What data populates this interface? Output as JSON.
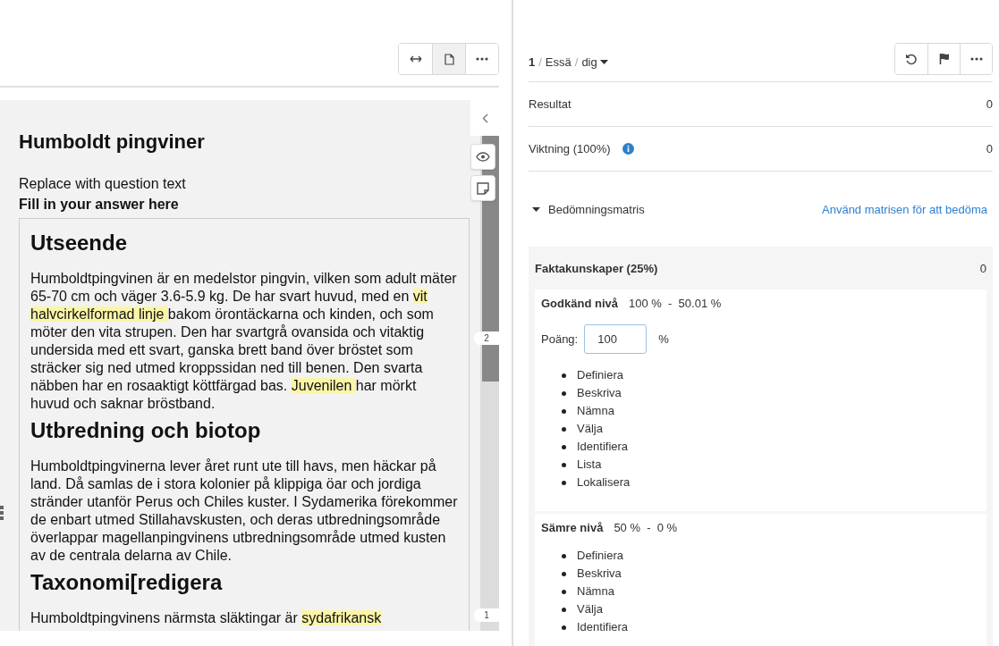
{
  "left_toolbar": {
    "buttons": [
      {
        "kind": "expand",
        "selected": false
      },
      {
        "kind": "page",
        "selected": true
      },
      {
        "kind": "more",
        "selected": false
      }
    ]
  },
  "question": {
    "title": "Humboldt pingviner",
    "text": "Replace with question text",
    "prompt": "Fill in your answer here",
    "answer": [
      {
        "kind": "heading",
        "text": "Utseende"
      },
      {
        "kind": "paragraph",
        "segments": [
          {
            "text": "Humboldtpingvinen är en medelstor pingvin, vilken som adult mäter 65-70 cm och väger 3.6-5.9 kg. De har svart huvud, med en ",
            "highlighted": false
          },
          {
            "text": "vit halvcirkelformad linje ",
            "highlighted": true
          },
          {
            "text": "bakom örontäckarna och kinden, och som möter den vita strupen. Den har svartgrå ovansida och vitaktig undersida med ett svart, ganska brett band över bröstet som sträcker sig ned utmed kroppssidan ned till benen. Den svarta näbben har en rosaaktigt köttfärgad bas. ",
            "highlighted": false
          },
          {
            "text": "Juvenilen ",
            "highlighted": true
          },
          {
            "text": "har mörkt huvud och saknar bröstband.",
            "highlighted": false
          }
        ]
      },
      {
        "kind": "heading",
        "text": "Utbredning och biotop"
      },
      {
        "kind": "paragraph",
        "segments": [
          {
            "text": "Humboldtpingvinerna lever året runt ute till havs, men häckar på land. Då samlas de i stora kolonier på klippiga öar och jordiga stränder utanför Perus och Chiles kuster. I Sydamerika förekommer de enbart utmed Stillahavskusten, och deras utbredningsområde överlappar magellanpingvinens utbredningsområde utmed kusten av de centrala delarna av Chile.",
            "highlighted": false
          }
        ]
      },
      {
        "kind": "heading",
        "text": "Taxonomi[redigera"
      },
      {
        "kind": "paragraph",
        "segments": [
          {
            "text": "Humboldtpingvinens närmsta släktingar är ",
            "highlighted": false
          },
          {
            "text": "sydafrikansk",
            "highlighted": true
          }
        ]
      }
    ]
  },
  "side_rail": {
    "markers": [
      {
        "label": "2"
      },
      {
        "label": "1"
      }
    ]
  },
  "header": {
    "number": "1",
    "separator": "/",
    "type": "Essä",
    "user": "dig"
  },
  "right_toolbar": {
    "buttons": [
      {
        "kind": "undo"
      },
      {
        "kind": "flag"
      },
      {
        "kind": "more"
      }
    ]
  },
  "rows": [
    {
      "label": "Resultat",
      "value": "0",
      "info": false
    },
    {
      "label": "Viktning (100%)",
      "value": "0",
      "info": true
    }
  ],
  "rubric": {
    "title": "Bedömningsmatris",
    "expanded": true,
    "link": "Använd matrisen för att bedöma",
    "criteria": [
      {
        "name": "Faktakunskaper (25%)",
        "score": "0",
        "levels": [
          {
            "name": "Godkänd nivå",
            "range": "100 %  -  50.01 %",
            "points_label": "Poäng:",
            "points": "100",
            "unit": "%",
            "items": [
              "Definiera",
              "Beskriva",
              "Nämna",
              "Välja",
              "Identifiera",
              "Lista",
              "Lokalisera"
            ]
          },
          {
            "name": "Sämre nivå",
            "range": "50 %  -  0 %",
            "items": [
              "Definiera",
              "Beskriva",
              "Nämna",
              "Välja",
              "Identifiera"
            ]
          }
        ]
      }
    ]
  }
}
